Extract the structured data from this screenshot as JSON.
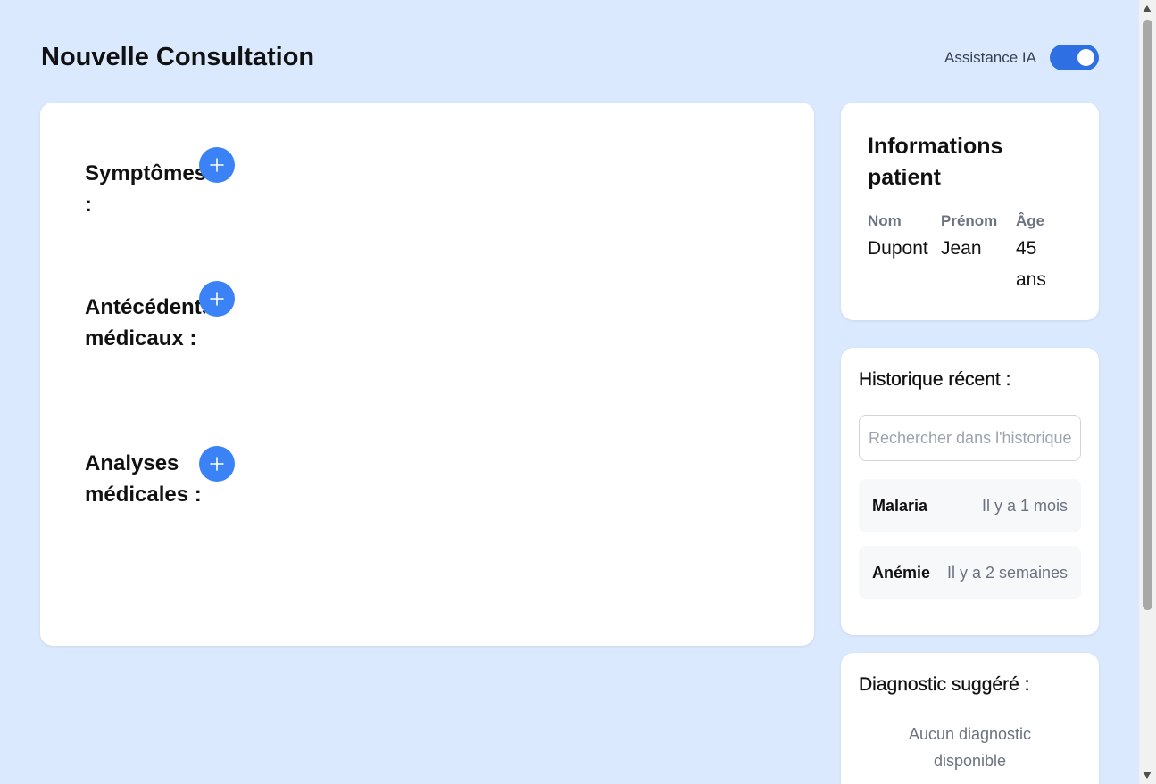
{
  "header": {
    "title": "Nouvelle Consultation",
    "ai_toggle_label": "Assistance IA",
    "ai_toggle_on": true
  },
  "sections": [
    {
      "title": "Symptômes :",
      "add_icon": "plus-icon"
    },
    {
      "title": "Antécédents médicaux :",
      "add_icon": "plus-icon"
    },
    {
      "title": "Analyses médicales :",
      "add_icon": "plus-icon"
    }
  ],
  "patient": {
    "title": "Informations patient",
    "nom_label": "Nom",
    "nom_value": "Dupont",
    "prenom_label": "Prénom",
    "prenom_value": "Jean",
    "age_label": "Âge",
    "age_value": "45 ans"
  },
  "history": {
    "title": "Historique récent :",
    "search_placeholder": "Rechercher dans l'historique...",
    "items": [
      {
        "name": "Malaria",
        "time": "Il y a 1 mois"
      },
      {
        "name": "Anémie",
        "time": "Il y a 2 semaines"
      }
    ]
  },
  "diagnostic": {
    "title": "Diagnostic suggéré :",
    "empty_text": "Aucun diagnostic disponible"
  },
  "colors": {
    "page_bg": "#dbe9fe",
    "accent": "#3b82f6",
    "toggle_on": "#2f6fe4"
  }
}
